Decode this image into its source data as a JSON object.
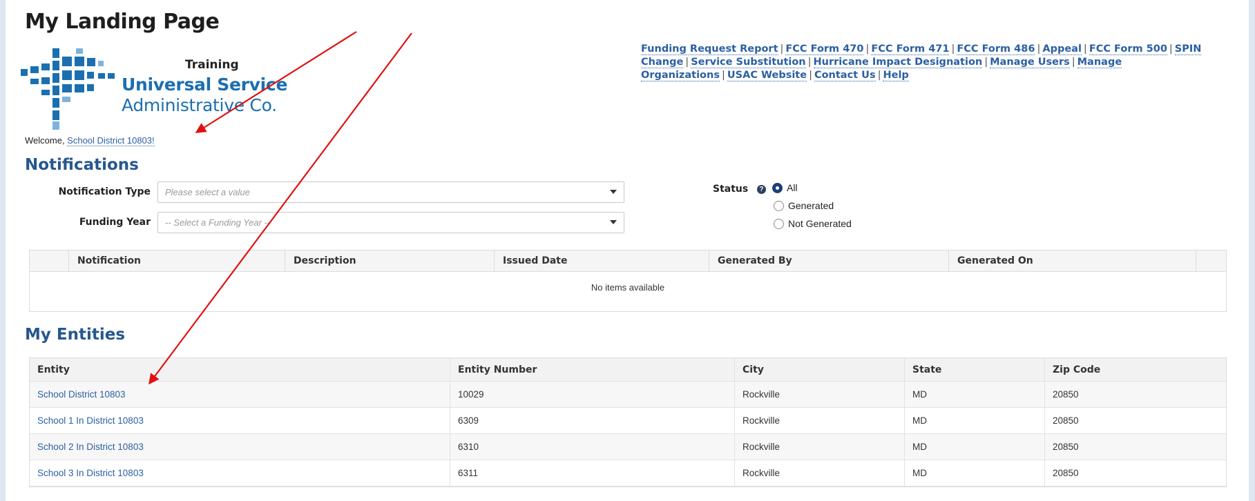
{
  "page": {
    "title": "My Landing Page",
    "welcome_prefix": "Welcome, ",
    "welcome_user": "School District 10803!"
  },
  "logo": {
    "training": "Training",
    "line1": "Universal Service",
    "line2": "Administrative Co.",
    "brand_color": "#1b6fb0"
  },
  "nav": {
    "links": [
      "Funding Request Report",
      "FCC Form 470",
      "FCC Form 471",
      "FCC Form 486",
      "Appeal",
      "FCC Form 500",
      "SPIN Change",
      "Service Substitution",
      "Hurricane Impact Designation",
      "Manage Users",
      "Manage Organizations",
      "USAC Website",
      "Contact Us",
      "Help"
    ]
  },
  "notifications": {
    "title": "Notifications",
    "type_label": "Notification Type",
    "type_placeholder": "Please select a value",
    "year_label": "Funding Year",
    "year_placeholder": "-- Select a Funding Year --",
    "status_label": "Status",
    "status_options": [
      "All",
      "Generated",
      "Not Generated"
    ],
    "status_selected": "All",
    "columns": [
      "Notification",
      "Description",
      "Issued Date",
      "Generated By",
      "Generated On"
    ],
    "empty_text": "No items available"
  },
  "entities": {
    "title": "My Entities",
    "columns": [
      "Entity",
      "Entity Number",
      "City",
      "State",
      "Zip Code"
    ],
    "rows": [
      [
        "School District 10803",
        "10029",
        "Rockville",
        "MD",
        "20850"
      ],
      [
        "School 1 In District 10803",
        "6309",
        "Rockville",
        "MD",
        "20850"
      ],
      [
        "School 2 In District 10803",
        "6310",
        "Rockville",
        "MD",
        "20850"
      ],
      [
        "School 3 In District 10803",
        "6311",
        "Rockville",
        "MD",
        "20850"
      ]
    ]
  },
  "colors": {
    "link": "#2b5fa3",
    "heading": "#25578f",
    "annotation_arrow": "#e01010"
  }
}
